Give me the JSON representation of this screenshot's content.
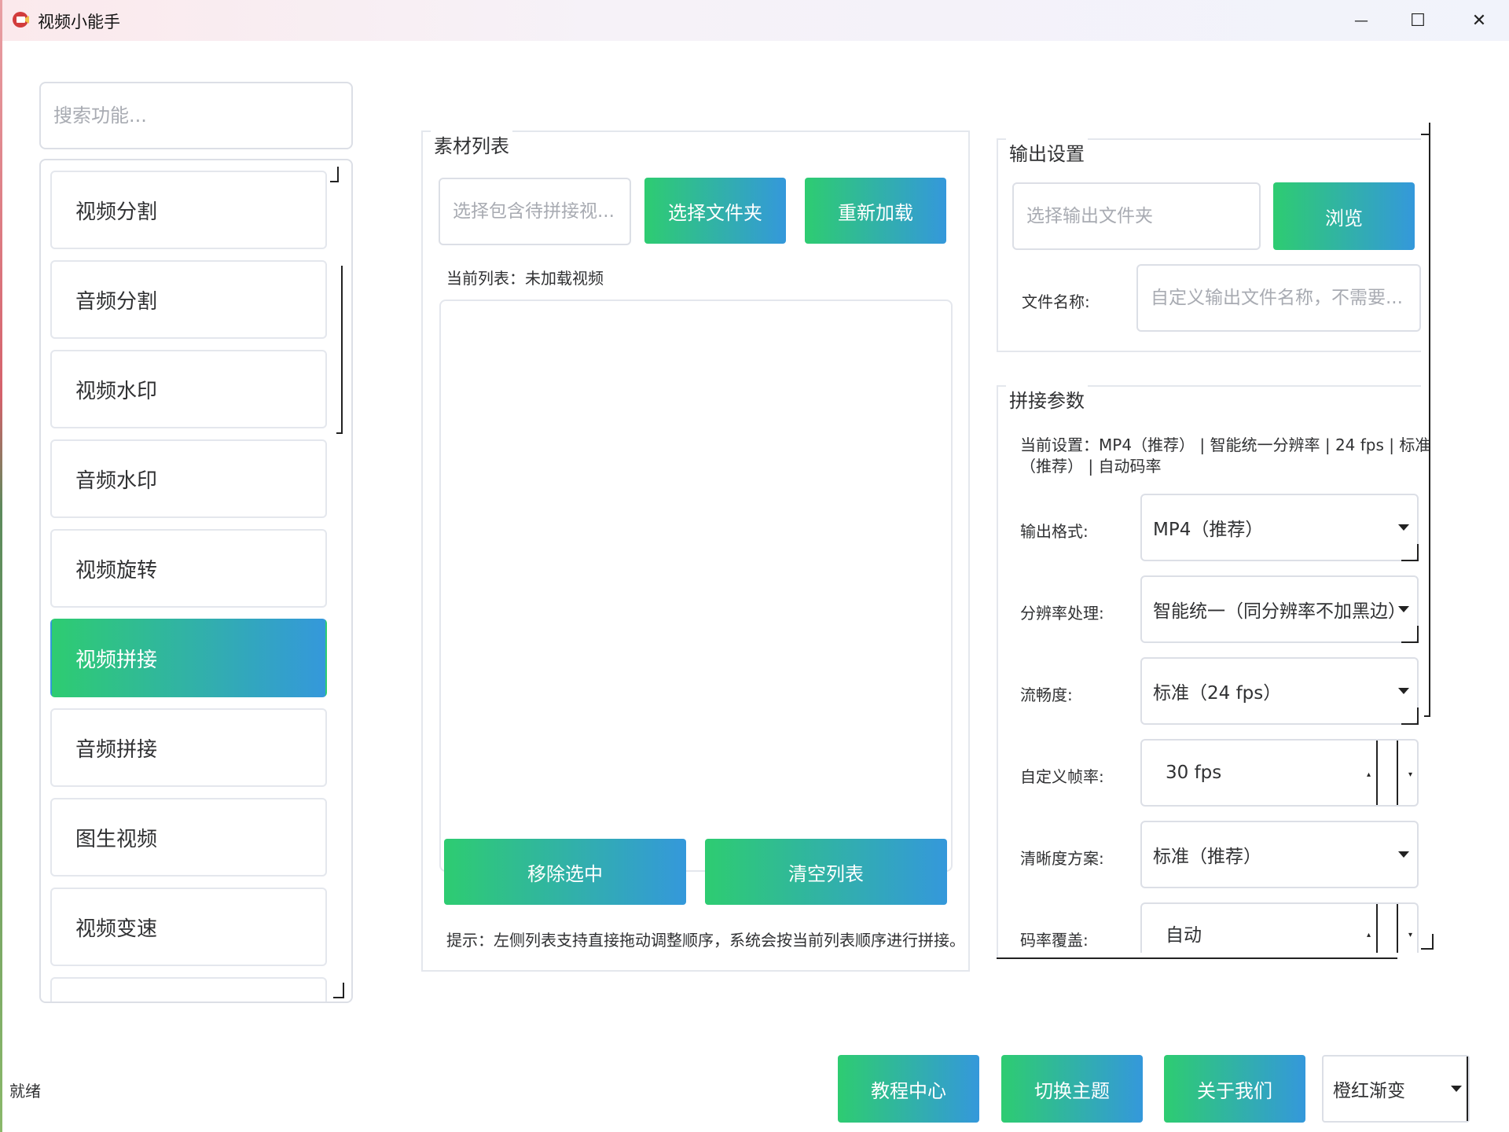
{
  "window": {
    "title": "视频小能手",
    "minimize_glyph": "—",
    "maximize_glyph": "☐",
    "close_glyph": "✕"
  },
  "sidebar": {
    "search_placeholder": "搜索功能...",
    "items": [
      {
        "label": "视频分割"
      },
      {
        "label": "音频分割"
      },
      {
        "label": "视频水印"
      },
      {
        "label": "音频水印"
      },
      {
        "label": "视频旋转"
      },
      {
        "label": "视频拼接",
        "active": true
      },
      {
        "label": "音频拼接"
      },
      {
        "label": "图生视频"
      },
      {
        "label": "视频变速"
      }
    ]
  },
  "material": {
    "title": "素材列表",
    "path_placeholder": "选择包含待拼接视...",
    "select_folder_label": "选择文件夹",
    "reload_label": "重新加载",
    "current_list_text": "当前列表：未加载视频",
    "remove_selected_label": "移除选中",
    "clear_list_label": "清空列表",
    "hint_text": "提示：左侧列表支持直接拖动调整顺序，系统会按当前列表顺序进行拼接。"
  },
  "output": {
    "title": "输出设置",
    "folder_placeholder": "选择输出文件夹",
    "browse_label": "浏览",
    "filename_label": "文件名称:",
    "filename_placeholder": "自定义输出文件名称，不需要..."
  },
  "params": {
    "title": "拼接参数",
    "current_settings_line1": "当前设置：MP4（推荐） | 智能统一分辨率 | 24 fps | 标准",
    "current_settings_line2": "（推荐） | 自动码率",
    "format_label": "输出格式:",
    "format_value": "MP4（推荐）",
    "resolution_label": "分辨率处理:",
    "resolution_value": "智能统一（同分辨率不加黑边）",
    "fluency_label": "流畅度:",
    "fluency_value": "标准（24 fps）",
    "custom_fps_label": "自定义帧率:",
    "custom_fps_value": "30 fps",
    "clarity_label": "清晰度方案:",
    "clarity_value": "标准（推荐）",
    "bitrate_label": "码率覆盖:",
    "bitrate_value": "自动"
  },
  "footer": {
    "status": "就绪",
    "tutorial_label": "教程中心",
    "switch_theme_label": "切换主题",
    "about_label": "关于我们",
    "theme_value": "橙红渐变"
  },
  "colors": {
    "gradient_start": "#2ecc71",
    "gradient_end": "#3498db"
  }
}
